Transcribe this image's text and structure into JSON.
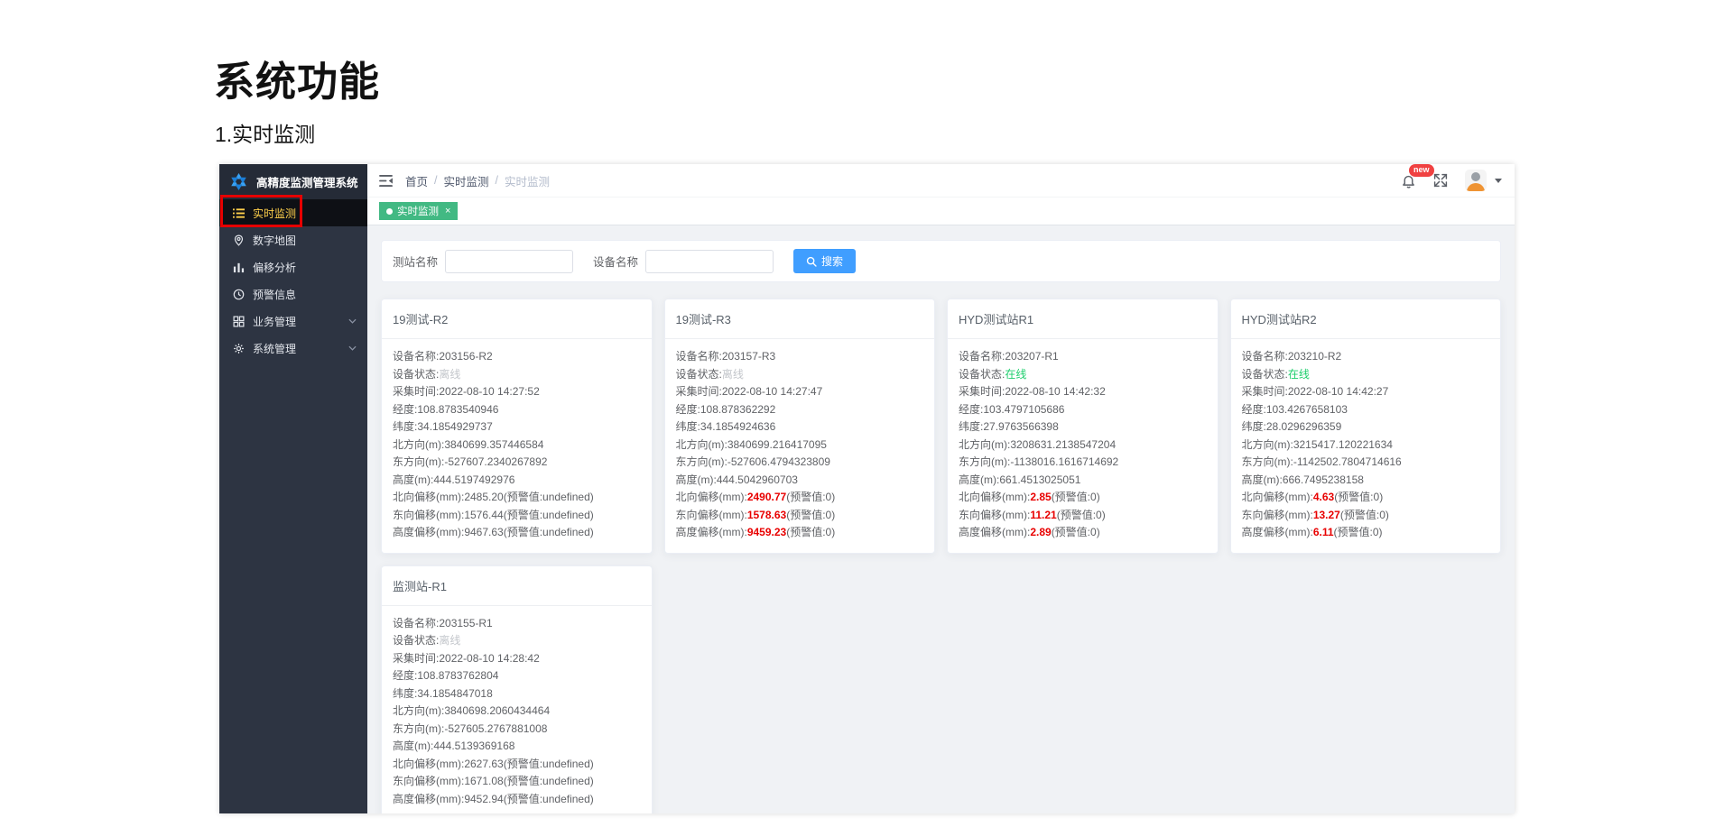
{
  "page": {
    "title": "系统功能",
    "subtitle": "1.实时监测"
  },
  "app": {
    "colors": {
      "sidebar_bg": "#2d3442",
      "sidebar_header_bg": "#252b37",
      "active_bg": "#0e1015",
      "active_text": "#ffd04b",
      "annotation_red": "#e60000",
      "tab_green": "#42b983",
      "primary_blue": "#409eff",
      "alarm_red": "#e80000",
      "online_green": "#1dce6c",
      "badge_red": "#f04141"
    },
    "sidebar": {
      "logo_text": "高精度监测管理系统",
      "items": [
        {
          "label": "实时监测",
          "icon": "list-icon",
          "active": true,
          "annotated": true
        },
        {
          "label": "数字地图",
          "icon": "map-pin-icon"
        },
        {
          "label": "偏移分析",
          "icon": "bar-chart-icon"
        },
        {
          "label": "预警信息",
          "icon": "clock-icon"
        },
        {
          "label": "业务管理",
          "icon": "grid-icon",
          "expandable": true
        },
        {
          "label": "系统管理",
          "icon": "gear-icon",
          "expandable": true
        }
      ]
    },
    "navbar": {
      "breadcrumb": [
        "首页",
        "实时监测",
        "实时监测"
      ],
      "separator": "/",
      "badge": "new"
    },
    "tabs": [
      {
        "label": "实时监测",
        "close": "×",
        "active": true
      }
    ],
    "search": {
      "station_label": "测站名称",
      "station_value": "",
      "device_label": "设备名称",
      "device_value": "",
      "button_label": "搜索"
    },
    "labels": {
      "device": "设备名称:",
      "status": "设备状态:",
      "time": "采集时间:",
      "lon": "经度:",
      "lat": "纬度:",
      "north": "北方向(m):",
      "east": "东方向(m):",
      "height": "高度(m):",
      "offset_north": "北向偏移(mm):",
      "offset_east": "东向偏移(mm):",
      "offset_height": "高度偏移(mm):"
    },
    "cards": [
      {
        "title": "19测试-R2",
        "device_name": "203156-R2",
        "status": "离线",
        "status_state": "offline",
        "time": "2022-08-10 14:27:52",
        "lon": "108.8783540946",
        "lat": "34.1854929737",
        "north": "3840699.357446584",
        "east": "-527607.2340267892",
        "height": "444.5197492976",
        "offsets": {
          "north": {
            "value": "2485.20",
            "warn": "(预警值:undefined)",
            "alarm": false
          },
          "east": {
            "value": "1576.44",
            "warn": "(预警值:undefined)",
            "alarm": false
          },
          "height": {
            "value": "9467.63",
            "warn": "(预警值:undefined)",
            "alarm": false
          }
        }
      },
      {
        "title": "19测试-R3",
        "device_name": "203157-R3",
        "status": "离线",
        "status_state": "offline",
        "time": "2022-08-10 14:27:47",
        "lon": "108.878362292",
        "lat": "34.1854924636",
        "north": "3840699.216417095",
        "east": "-527606.4794323809",
        "height": "444.5042960703",
        "offsets": {
          "north": {
            "value": "2490.77",
            "warn": "(预警值:0)",
            "alarm": true
          },
          "east": {
            "value": "1578.63",
            "warn": "(预警值:0)",
            "alarm": true
          },
          "height": {
            "value": "9459.23",
            "warn": "(预警值:0)",
            "alarm": true
          }
        }
      },
      {
        "title": "HYD测试站R1",
        "device_name": "203207-R1",
        "status": "在线",
        "status_state": "online",
        "time": "2022-08-10 14:42:32",
        "lon": "103.4797105686",
        "lat": "27.9763566398",
        "north": "3208631.2138547204",
        "east": "-1138016.1616714692",
        "height": "661.4513025051",
        "offsets": {
          "north": {
            "value": "2.85",
            "warn": "(预警值:0)",
            "alarm": true
          },
          "east": {
            "value": "11.21",
            "warn": "(预警值:0)",
            "alarm": true
          },
          "height": {
            "value": "2.89",
            "warn": "(预警值:0)",
            "alarm": true
          }
        }
      },
      {
        "title": "HYD测试站R2",
        "device_name": "203210-R2",
        "status": "在线",
        "status_state": "online",
        "time": "2022-08-10 14:42:27",
        "lon": "103.4267658103",
        "lat": "28.0296296359",
        "north": "3215417.120221634",
        "east": "-1142502.7804714616",
        "height": "666.7495238158",
        "offsets": {
          "north": {
            "value": "4.63",
            "warn": "(预警值:0)",
            "alarm": true
          },
          "east": {
            "value": "13.27",
            "warn": "(预警值:0)",
            "alarm": true
          },
          "height": {
            "value": "6.11",
            "warn": "(预警值:0)",
            "alarm": true
          }
        }
      },
      {
        "title": "监测站-R1",
        "device_name": "203155-R1",
        "status": "离线",
        "status_state": "offline",
        "time": "2022-08-10 14:28:42",
        "lon": "108.8783762804",
        "lat": "34.1854847018",
        "north": "3840698.2060434464",
        "east": "-527605.2767881008",
        "height": "444.5139369168",
        "offsets": {
          "north": {
            "value": "2627.63",
            "warn": "(预警值:undefined)",
            "alarm": false
          },
          "east": {
            "value": "1671.08",
            "warn": "(预警值:undefined)",
            "alarm": false
          },
          "height": {
            "value": "9452.94",
            "warn": "(预警值:undefined)",
            "alarm": false
          }
        }
      }
    ]
  }
}
